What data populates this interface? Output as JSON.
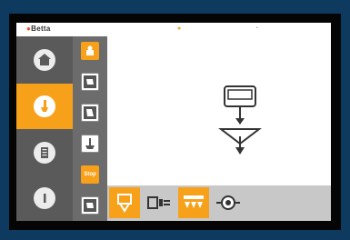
{
  "brand": {
    "name": "Betta"
  },
  "status": {
    "warning_icon": "warning-icon",
    "info_icon": "info-icon"
  },
  "sidebar": {
    "items": [
      {
        "name": "home-icon",
        "active": false
      },
      {
        "name": "tool-icon",
        "active": true
      },
      {
        "name": "list-icon",
        "active": false
      },
      {
        "name": "info-icon",
        "active": false
      }
    ]
  },
  "subbar": {
    "items": [
      {
        "name": "tool-settings-icon",
        "active": true
      },
      {
        "name": "tool-measure-icon",
        "active": false
      },
      {
        "name": "tool-change-icon",
        "active": false
      },
      {
        "name": "tool-position-icon",
        "active": false
      },
      {
        "name": "stop-button",
        "label": "Stop",
        "active": true
      },
      {
        "name": "tool-extra-icon",
        "active": false
      }
    ]
  },
  "bottombar": {
    "items": [
      {
        "name": "tool-holder-icon",
        "active": true
      },
      {
        "name": "connector-icon",
        "active": false
      },
      {
        "name": "multi-tool-icon",
        "active": true
      },
      {
        "name": "axis-icon",
        "active": false
      }
    ]
  },
  "colors": {
    "accent": "#f7a11a",
    "sidebar": "#5a5a5a",
    "subbar": "#6c6c6c",
    "bottombar": "#c8c8c8"
  }
}
